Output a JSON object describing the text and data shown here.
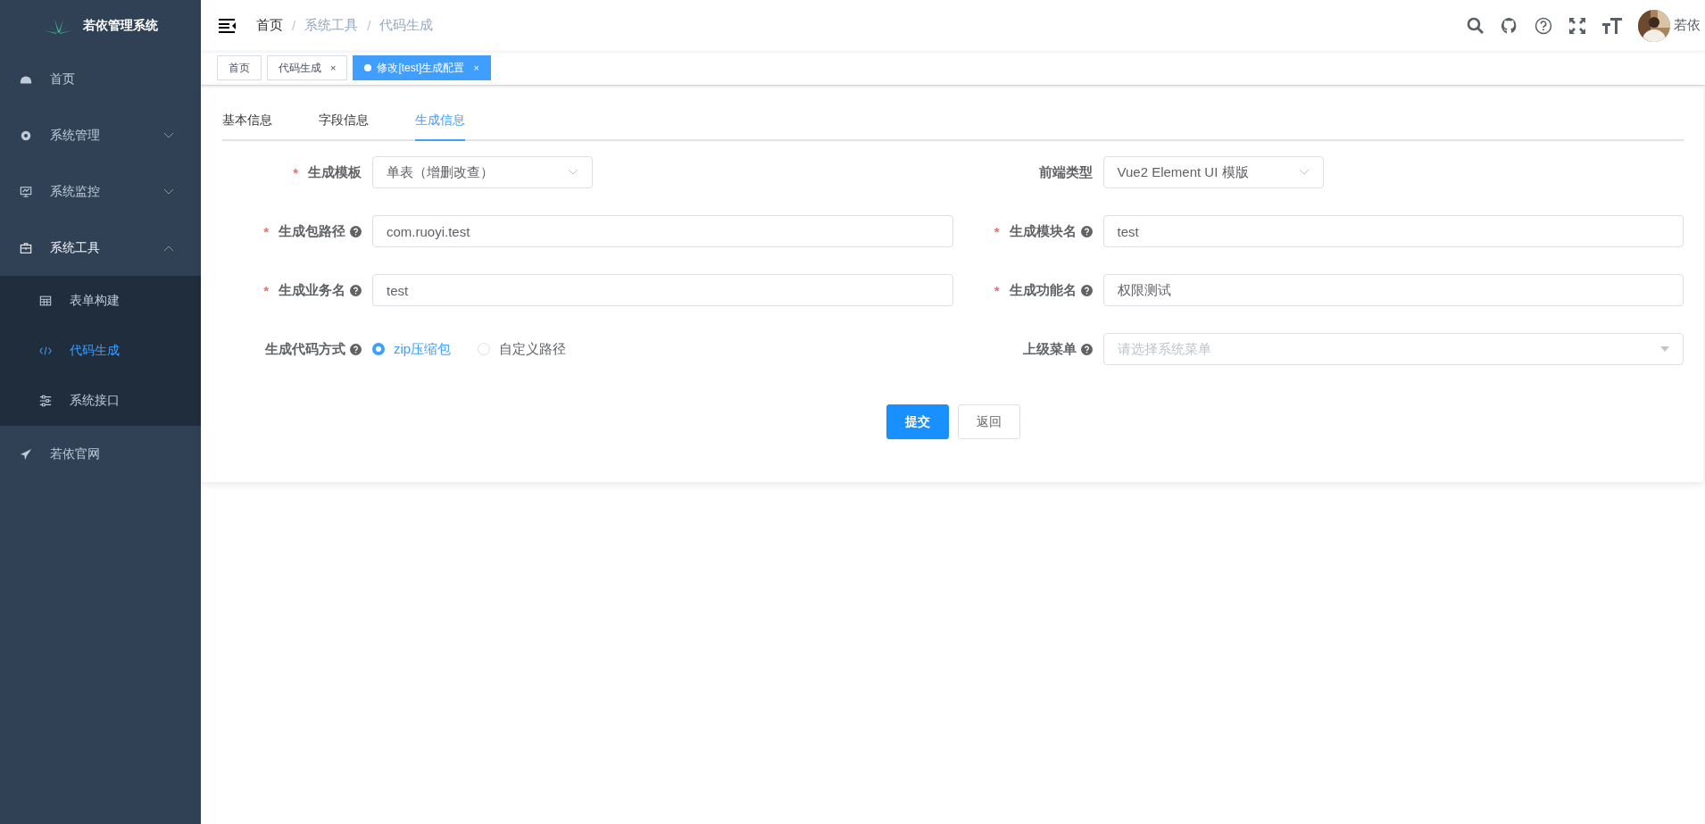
{
  "sidebar": {
    "title": "若依管理系统",
    "items": [
      {
        "label": "首页",
        "selected": false
      },
      {
        "label": "系统管理",
        "expanded": false,
        "selected": false
      },
      {
        "label": "系统监控",
        "expanded": false,
        "selected": false
      },
      {
        "label": "系统工具",
        "expanded": true,
        "selected": false,
        "children": [
          {
            "label": "表单构建",
            "selected": false
          },
          {
            "label": "代码生成",
            "selected": true
          },
          {
            "label": "系统接口",
            "selected": false
          }
        ]
      },
      {
        "label": "若依官网",
        "selected": false
      }
    ]
  },
  "breadcrumb": [
    {
      "label": "首页",
      "link": true
    },
    {
      "separator": "/",
      "label": "系统工具",
      "link": false
    },
    {
      "separator": "/",
      "label": "代码生成",
      "link": false
    }
  ],
  "user": {
    "name": "若依"
  },
  "tags": [
    {
      "label": "首页",
      "selected": false,
      "closable": false
    },
    {
      "label": "代码生成",
      "selected": false,
      "closable": true,
      "close": "×"
    },
    {
      "label": "修改[test]生成配置",
      "selected": true,
      "closable": true,
      "close": "×"
    }
  ],
  "tabs": [
    {
      "label": "基本信息",
      "selected": false
    },
    {
      "label": "字段信息",
      "selected": false
    },
    {
      "label": "生成信息",
      "selected": true
    }
  ],
  "rows": [
    {
      "left": {
        "kind": "select",
        "label": "生成模板",
        "required_mark": "*",
        "value": "单表（增删改查）"
      },
      "right": {
        "kind": "select",
        "label": "前端类型",
        "value": "Vue2 Element UI 模版"
      }
    },
    {
      "left": {
        "kind": "input",
        "label": "生成包路径",
        "required_mark": "*",
        "help": true,
        "value": "com.ruoyi.test"
      },
      "right": {
        "kind": "input",
        "label": "生成模块名",
        "required_mark": "*",
        "help": true,
        "value": "test"
      }
    },
    {
      "left": {
        "kind": "input",
        "label": "生成业务名",
        "required_mark": "*",
        "help": true,
        "value": "test"
      },
      "right": {
        "kind": "input",
        "label": "生成功能名",
        "required_mark": "*",
        "help": true,
        "value": "权限测试"
      }
    },
    {
      "left": {
        "kind": "radio",
        "label": "生成代码方式",
        "help": true,
        "options": [
          {
            "label": "zip压缩包",
            "selected": true
          },
          {
            "label": "自定义路径",
            "selected": false
          }
        ]
      },
      "right": {
        "kind": "treeselect",
        "label": "上级菜单",
        "help": true,
        "placeholder": "请选择系统菜单"
      }
    }
  ],
  "buttons": [
    {
      "label": "提交",
      "kind": "primary"
    },
    {
      "label": "返回",
      "kind": "default"
    }
  ]
}
